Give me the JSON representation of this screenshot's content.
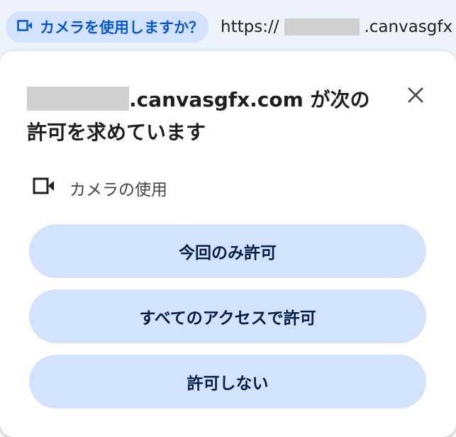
{
  "omnibox": {
    "permission_chip_label": "カメラを使用しますか？",
    "url_prefix": "https://",
    "url_domain": ".canvasgfx"
  },
  "dialog": {
    "title_domain": ".canvasgfx.com",
    "title_rest": " が次の許可を求めています",
    "permission_label": "カメラの使用",
    "buttons": {
      "allow_once": "今回のみ許可",
      "allow_always": "すべてのアクセスで許可",
      "deny": "許可しない"
    }
  },
  "icons": {
    "chip_icon": "video-camera-icon",
    "close_icon": "close-icon",
    "permission_icon": "video-camera-icon"
  },
  "colors": {
    "chip_bg": "#d3e3fd",
    "chip_text": "#0b57d0",
    "button_bg": "#d3e3fd",
    "button_text": "#041e49"
  }
}
